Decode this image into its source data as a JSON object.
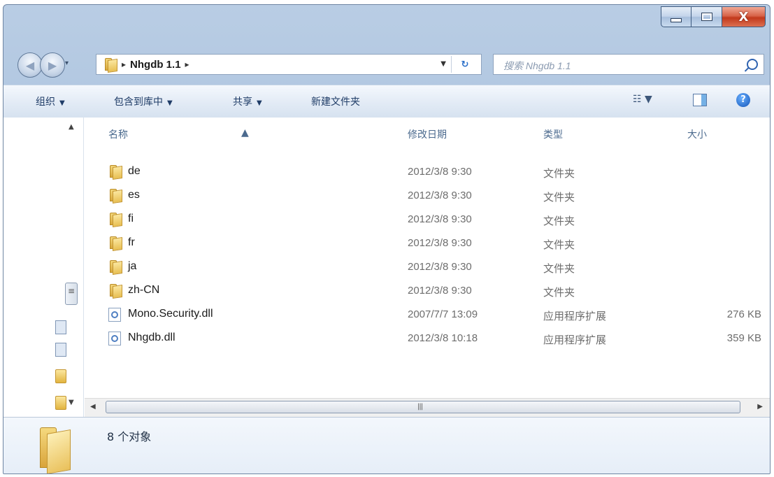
{
  "window": {
    "caption": {
      "minimize": "",
      "maximize": "",
      "close": "X"
    }
  },
  "address": {
    "separator": "▸",
    "crumb": "Nhgdb 1.1",
    "search_placeholder": "搜索 Nhgdb 1.1"
  },
  "toolbar": {
    "organize": "组织",
    "include_in_library": "包含到库中",
    "share": "共享",
    "new_folder": "新建文件夹"
  },
  "columns": {
    "name": "名称",
    "modified": "修改日期",
    "type": "类型",
    "size": "大小"
  },
  "files": [
    {
      "name": "de",
      "modified": "2012/3/8 9:30",
      "type": "文件夹",
      "size": "",
      "icon": "folder-icon"
    },
    {
      "name": "es",
      "modified": "2012/3/8 9:30",
      "type": "文件夹",
      "size": "",
      "icon": "folder-icon"
    },
    {
      "name": "fi",
      "modified": "2012/3/8 9:30",
      "type": "文件夹",
      "size": "",
      "icon": "folder-icon"
    },
    {
      "name": "fr",
      "modified": "2012/3/8 9:30",
      "type": "文件夹",
      "size": "",
      "icon": "folder-icon"
    },
    {
      "name": "ja",
      "modified": "2012/3/8 9:30",
      "type": "文件夹",
      "size": "",
      "icon": "folder-icon"
    },
    {
      "name": "zh-CN",
      "modified": "2012/3/8 9:30",
      "type": "文件夹",
      "size": "",
      "icon": "folder-icon"
    },
    {
      "name": "Mono.Security.dll",
      "modified": "2007/7/7 13:09",
      "type": "应用程序扩展",
      "size": "276 KB",
      "icon": "dll-icon"
    },
    {
      "name": "Nhgdb.dll",
      "modified": "2012/3/8 10:18",
      "type": "应用程序扩展",
      "size": "359 KB",
      "icon": "dll-icon"
    }
  ],
  "status": {
    "item_count": "8 个对象"
  }
}
